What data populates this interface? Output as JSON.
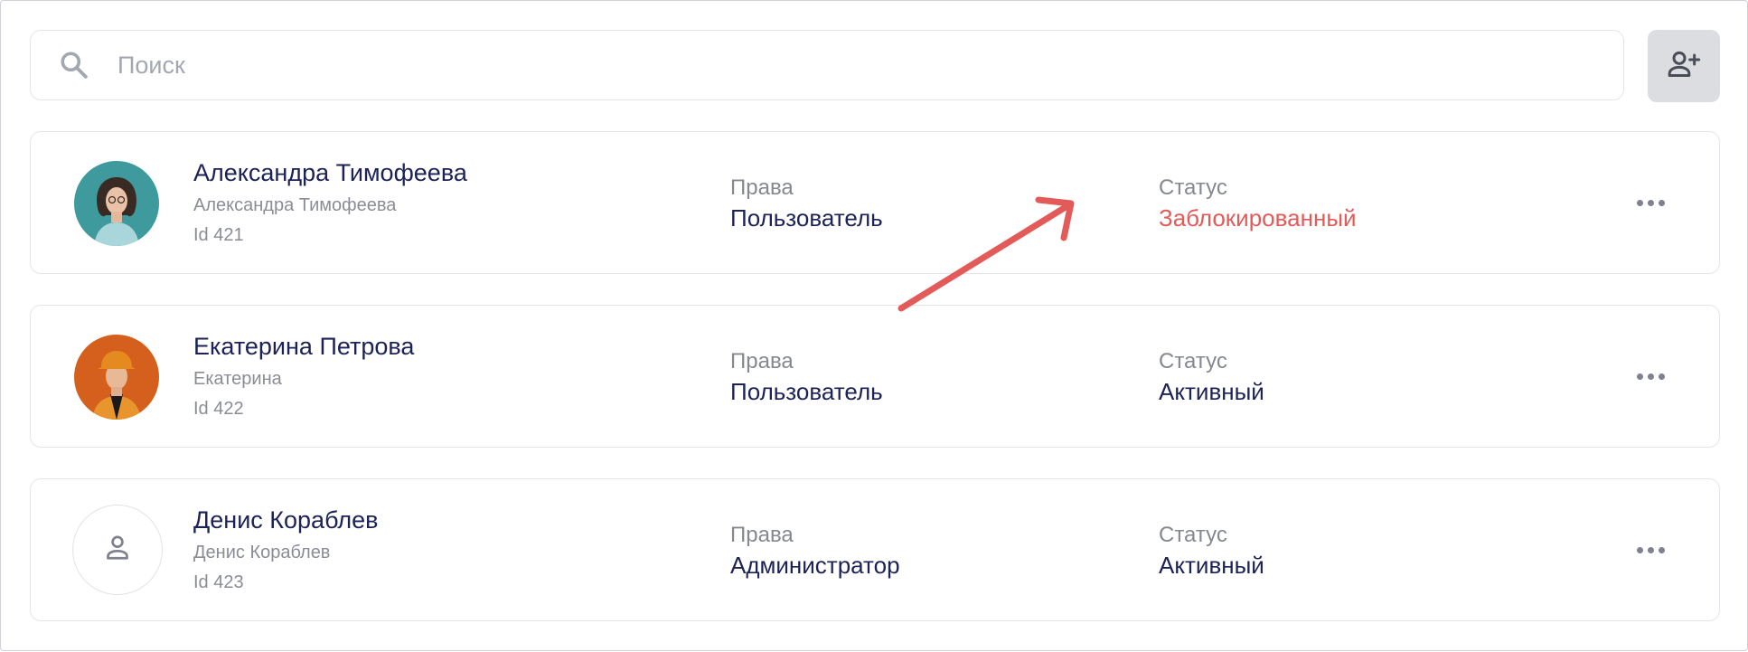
{
  "search": {
    "placeholder": "Поиск",
    "value": "",
    "icon": "search-icon"
  },
  "toolbar": {
    "add_user_icon": "person-add-icon"
  },
  "users": [
    {
      "name": "Александра Тимофеева",
      "login": "Александра Тимофеева",
      "id": "Id 421",
      "avatar": "photo",
      "rights_label": "Права",
      "rights_value": "Пользователь",
      "status_label": "Статус",
      "status_value": "Заблокированный",
      "status_color": "#e35b59"
    },
    {
      "name": "Екатерина Петрова",
      "login": "Екатерина",
      "id": "Id 422",
      "avatar": "photo",
      "rights_label": "Права",
      "rights_value": "Пользователь",
      "status_label": "Статус",
      "status_value": "Активный",
      "status_color": "#1c2257"
    },
    {
      "name": "Денис Кораблев",
      "login": "Денис Кораблев",
      "id": "Id 423",
      "avatar": "person-placeholder-icon",
      "rights_label": "Права",
      "rights_value": "Администратор",
      "status_label": "Статус",
      "status_value": "Активный",
      "status_color": "#1c2257"
    }
  ],
  "colors": {
    "text_primary": "#1c2257",
    "text_secondary": "#8a8d96",
    "blocked": "#e35b59",
    "annotation_arrow": "#e35b59",
    "button_bg": "#dcdde0"
  }
}
